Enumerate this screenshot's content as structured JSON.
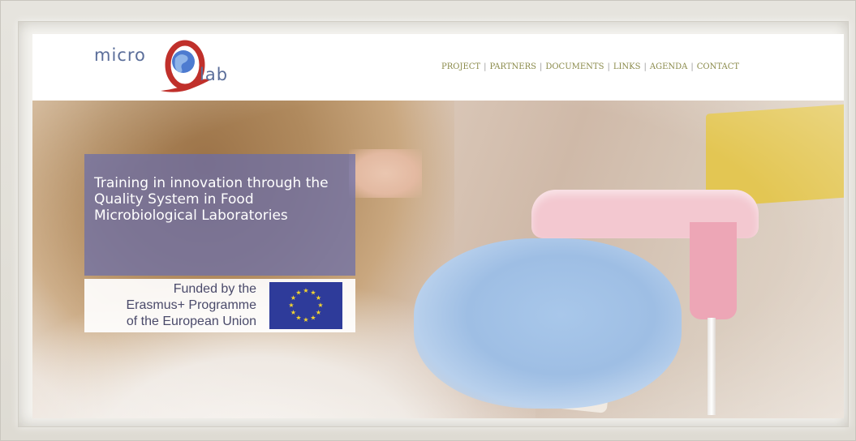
{
  "logo": {
    "text_micro": "micro",
    "text_lab": "lab",
    "colors": {
      "text": "#5b6e9a",
      "q_red": "#c0302b",
      "globe_blue": "#4d7bd0"
    }
  },
  "nav": {
    "items": [
      {
        "label": "PROJECT"
      },
      {
        "label": "PARTNERS"
      },
      {
        "label": "DOCUMENTS"
      },
      {
        "label": "LINKS"
      },
      {
        "label": "AGENDA"
      },
      {
        "label": "CONTACT"
      }
    ],
    "separator": "|",
    "color": "#8a8a4a"
  },
  "hero": {
    "tagline": "Training in innovation through the Quality System in Food Microbiological Laboratories",
    "tagline_box_color": "#696eaa",
    "erasmus_text": "Funded by the\nErasmus+ Programme\nof the European Union",
    "eu_flag_color": "#2e3b9a",
    "eu_star_color": "#f5d52f"
  }
}
